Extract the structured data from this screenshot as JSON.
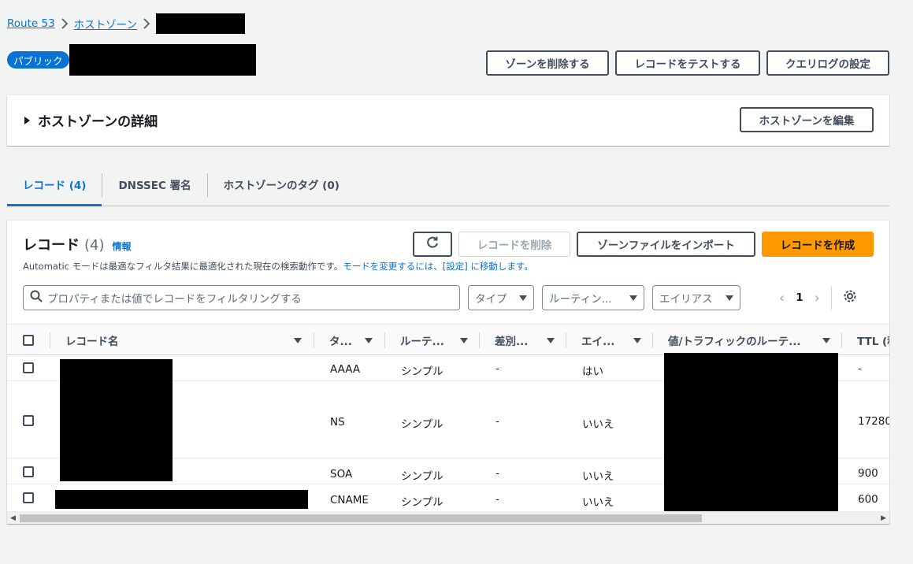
{
  "breadcrumb": {
    "items": [
      "Route 53",
      "ホストゾーン"
    ]
  },
  "header": {
    "badge": "パブリック",
    "buttons": {
      "delete_zone": "ゾーンを削除する",
      "test_record": "レコードをテストする",
      "query_log": "クエリログの設定"
    }
  },
  "details": {
    "title": "ホストゾーンの詳細",
    "edit_button": "ホストゾーンを編集"
  },
  "tabs": [
    {
      "label": "レコード (4)"
    },
    {
      "label": "DNSSEC 署名"
    },
    {
      "label": "ホストゾーンのタグ (0)"
    }
  ],
  "records": {
    "title": "レコード",
    "count": "(4)",
    "info": "情報",
    "desc_text": "Automatic モードは最適なフィルタ結果に最適化された現在の検索動作です。",
    "desc_link": "モードを変更するには、[設定] に移動します。",
    "buttons": {
      "delete": "レコードを削除",
      "import": "ゾーンファイルをインポート",
      "create": "レコードを作成"
    },
    "search_placeholder": "プロパティまたは値でレコードをフィルタリングする",
    "filters": {
      "type": "タイプ",
      "routing": "ルーティン...",
      "alias": "エイリアス"
    },
    "page": "1",
    "columns": {
      "name": "レコード名",
      "type": "タ...",
      "routing": "ルーテ...",
      "diff": "差別...",
      "alias": "エイ...",
      "value": "値/トラフィックのルーテ...",
      "ttl": "TTL (秒"
    },
    "rows": [
      {
        "type": "AAAA",
        "routing": "シンプル",
        "diff": "-",
        "alias": "はい",
        "ttl": "-"
      },
      {
        "type": "NS",
        "routing": "シンプル",
        "diff": "-",
        "alias": "いいえ",
        "ttl": "17280"
      },
      {
        "type": "SOA",
        "routing": "シンプル",
        "diff": "-",
        "alias": "いいえ",
        "ttl": "900"
      },
      {
        "type": "CNAME",
        "routing": "シンプル",
        "diff": "-",
        "alias": "いいえ",
        "ttl": "600"
      }
    ]
  },
  "colors": {
    "accent": "#0972d3",
    "primary": "#ff9900"
  }
}
